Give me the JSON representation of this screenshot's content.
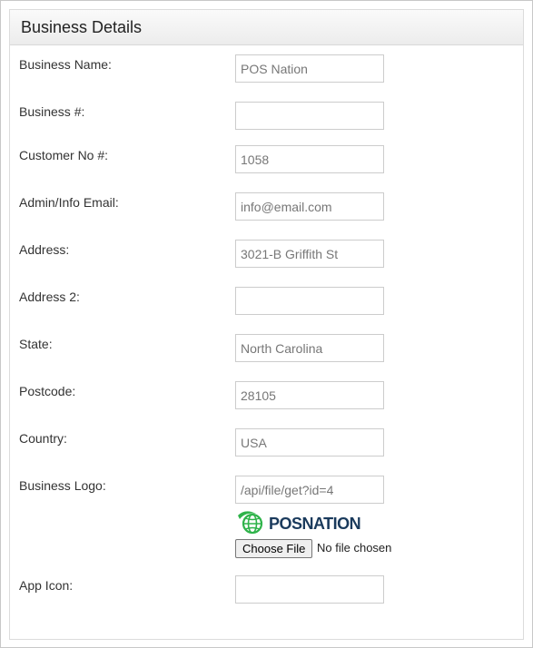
{
  "panel": {
    "title": "Business Details"
  },
  "fields": [
    {
      "label": "Business Name:",
      "value": "POS Nation"
    },
    {
      "label": "Business #:",
      "value": ""
    },
    {
      "label": "Customer No #:",
      "value": "1058"
    },
    {
      "label": "Admin/Info Email:",
      "value": "info@email.com"
    },
    {
      "label": "Address:",
      "value": "3021-B Griffith St"
    },
    {
      "label": "Address 2:",
      "value": ""
    },
    {
      "label": "State:",
      "value": "North Carolina"
    },
    {
      "label": "Postcode:",
      "value": "28105"
    },
    {
      "label": "Country:",
      "value": "USA"
    },
    {
      "label": "Business Logo:",
      "value": "/api/file/get?id=4"
    },
    {
      "label": "App Icon:",
      "value": ""
    }
  ],
  "logo": {
    "text": "POSNATION",
    "icon": "globe-swoosh-icon",
    "colors": {
      "green": "#2fb34a",
      "navy": "#1a3a5c"
    }
  },
  "file_upload": {
    "button_label": "Choose File",
    "status": "No file chosen"
  }
}
